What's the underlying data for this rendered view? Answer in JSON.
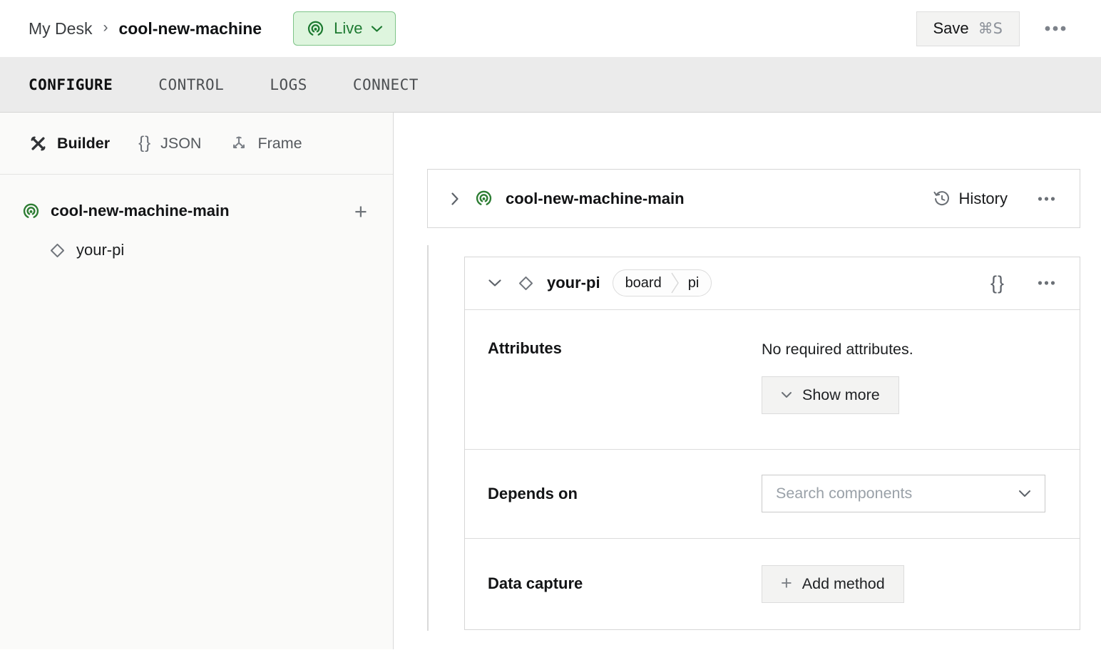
{
  "topbar": {
    "breadcrumb": {
      "parent": "My Desk",
      "separator": "›",
      "current": "cool-new-machine"
    },
    "live_badge": {
      "label": "Live"
    },
    "save_button": {
      "label": "Save",
      "shortcut": "⌘S"
    }
  },
  "tabs": [
    {
      "label": "CONFIGURE",
      "active": true
    },
    {
      "label": "CONTROL",
      "active": false
    },
    {
      "label": "LOGS",
      "active": false
    },
    {
      "label": "CONNECT",
      "active": false
    }
  ],
  "sidebar": {
    "views": [
      {
        "label": "Builder",
        "icon": "tools-icon",
        "active": true
      },
      {
        "label": "JSON",
        "icon": "braces-icon",
        "active": false
      },
      {
        "label": "Frame",
        "icon": "frame-axes-icon",
        "active": false
      }
    ],
    "tree": {
      "machine_part": {
        "label": "cool-new-machine-main",
        "add_label": "+"
      },
      "children": [
        {
          "label": "your-pi"
        }
      ]
    },
    "json_icon_glyph": "{}"
  },
  "main": {
    "part_card": {
      "title": "cool-new-machine-main",
      "history_label": "History"
    },
    "component_card": {
      "title": "your-pi",
      "badges": [
        "board",
        "pi"
      ],
      "braces_glyph": "{}",
      "sections": {
        "attributes": {
          "heading": "Attributes",
          "empty_text": "No required attributes.",
          "show_more_label": "Show more"
        },
        "depends_on": {
          "heading": "Depends on",
          "search_placeholder": "Search components"
        },
        "data_capture": {
          "heading": "Data capture",
          "add_method_label": "Add method"
        }
      }
    }
  },
  "colors": {
    "live_badge_bg": "#def5de",
    "live_badge_border": "#7ec488",
    "live_badge_text": "#1d7a31",
    "machine_icon_green": "#2d7d33",
    "tabbar_bg": "#ebebeb",
    "card_border": "#d6d6d6"
  }
}
